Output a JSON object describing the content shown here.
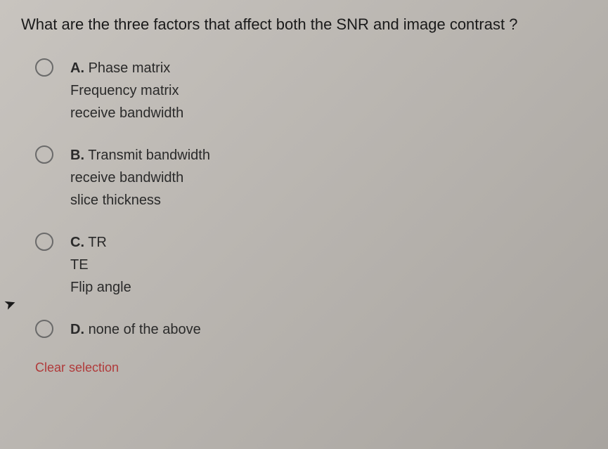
{
  "question": "What are the three factors that affect both the SNR and image contrast ?",
  "options": [
    {
      "letter": "A.",
      "lines": [
        "Phase matrix",
        "Frequency matrix",
        "receive bandwidth"
      ]
    },
    {
      "letter": "B.",
      "lines": [
        "Transmit bandwidth",
        "receive bandwidth",
        "slice thickness"
      ]
    },
    {
      "letter": "C.",
      "lines": [
        "TR",
        "TE",
        "Flip angle"
      ]
    },
    {
      "letter": "D.",
      "lines": [
        "none of the above"
      ]
    }
  ],
  "clear_label": "Clear selection"
}
